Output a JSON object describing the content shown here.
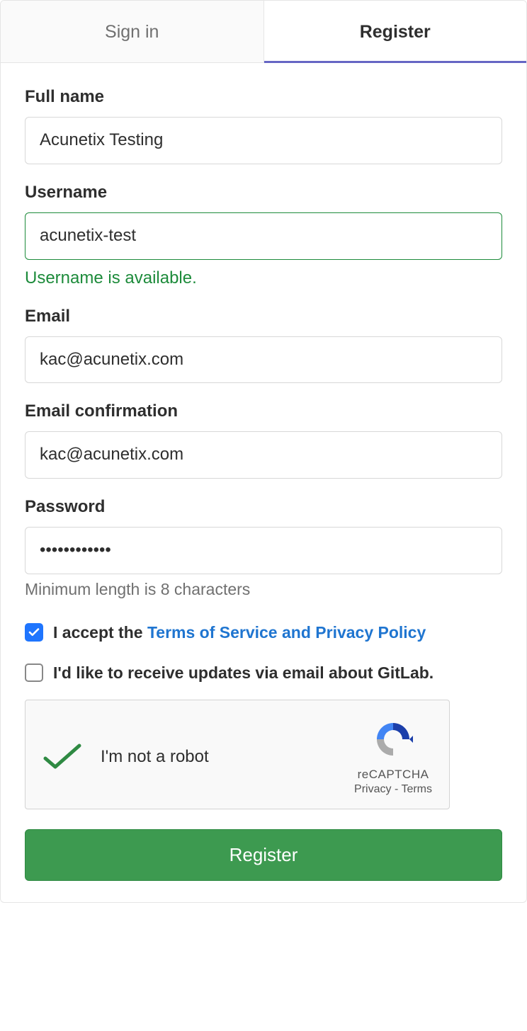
{
  "tabs": {
    "signin": "Sign in",
    "register": "Register"
  },
  "fields": {
    "fullname": {
      "label": "Full name",
      "value": "Acunetix Testing"
    },
    "username": {
      "label": "Username",
      "value": "acunetix-test",
      "status": "Username is available."
    },
    "email": {
      "label": "Email",
      "value": "kac@acunetix.com"
    },
    "email_confirm": {
      "label": "Email confirmation",
      "value": "kac@acunetix.com"
    },
    "password": {
      "label": "Password",
      "value": "••••••••••••",
      "hint": "Minimum length is 8 characters"
    }
  },
  "terms": {
    "prefix": "I accept the ",
    "link": "Terms of Service and Privacy Policy"
  },
  "updates": {
    "label": "I'd like to receive updates via email about GitLab."
  },
  "captcha": {
    "label": "I'm not a robot",
    "brand": "reCAPTCHA",
    "privacy": "Privacy",
    "sep": " - ",
    "terms": "Terms"
  },
  "submit": "Register"
}
